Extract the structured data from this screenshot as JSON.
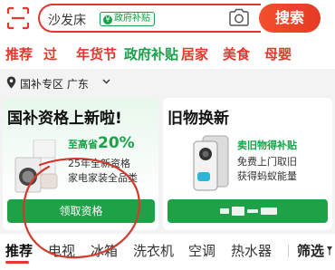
{
  "search": {
    "query": "沙发床",
    "gov_tag": "政府补贴",
    "gov_tag_mark": "¥",
    "button_label": "搜索"
  },
  "categories": [
    {
      "label": "推荐",
      "color": "#e4382c"
    },
    {
      "label": "过",
      "color": "#e4382c"
    },
    {
      "label": "年货节",
      "color": "#e4382c"
    },
    {
      "label": "政府补贴",
      "color": "#19a04a"
    },
    {
      "label": "居家",
      "color": "#e4382c"
    },
    {
      "label": "美食",
      "color": "#e4382c"
    },
    {
      "label": "母婴",
      "color": "#e4382c"
    }
  ],
  "location": {
    "label": "国补专区 广东"
  },
  "card_left": {
    "title": "国补资格上新啦!",
    "promo_prefix": "至高省",
    "promo_percent": "20%",
    "line2": "25年全新资格",
    "line3": "家电家装全品类",
    "button_label": "领取资格"
  },
  "card_right": {
    "title": "旧物换新",
    "line1": "卖旧物得补贴",
    "line2": "免费上门取旧",
    "line3": "获得蚂蚁能量"
  },
  "bottom_tabs": [
    "推荐",
    "电视",
    "冰箱",
    "洗衣机",
    "空调",
    "热水器"
  ],
  "filter_label": "筛选",
  "colors": {
    "accent": "#e4382c",
    "green": "#1fa247"
  }
}
